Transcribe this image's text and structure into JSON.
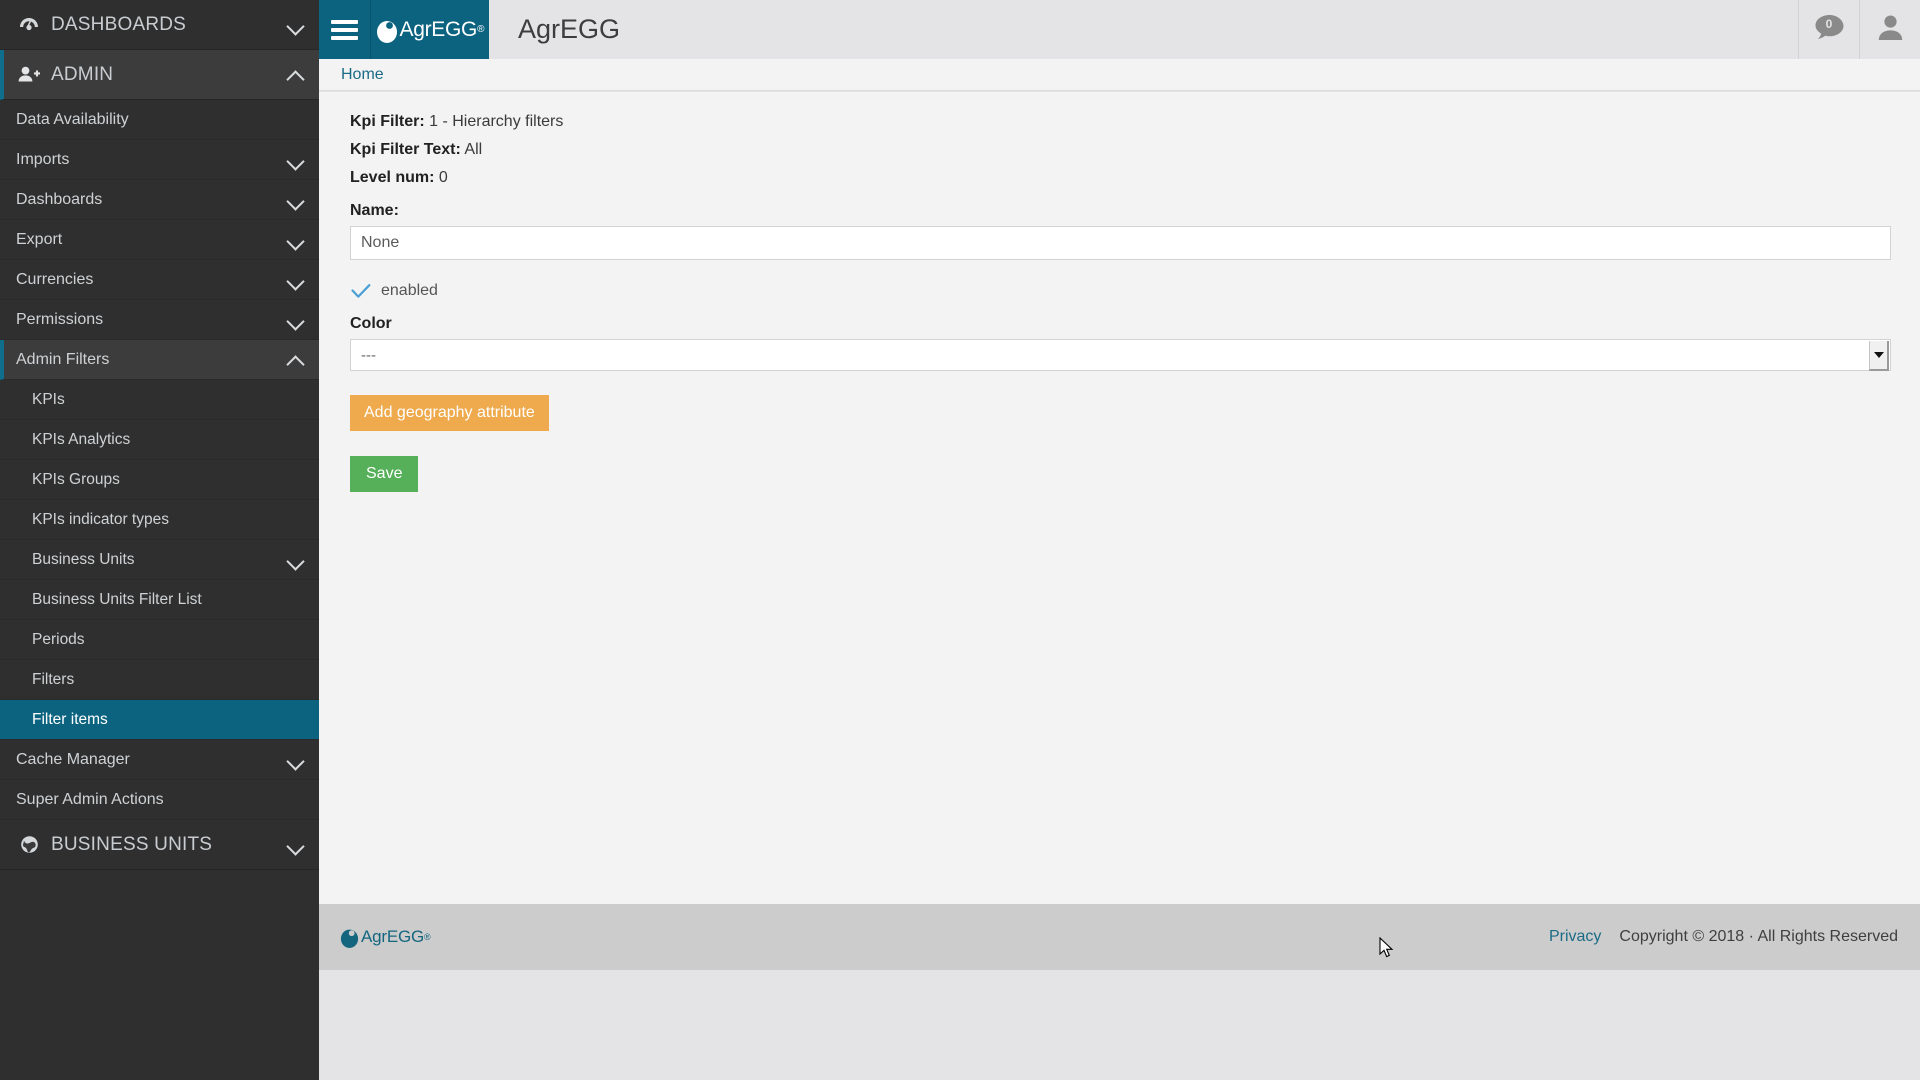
{
  "app": {
    "brand_name": "AgrEGG",
    "brand_reg": "®",
    "header_title": "AgrEGG",
    "notif_count": "0",
    "menu_icon": "hamburger-icon",
    "notif_icon": "speech-bubble-icon",
    "user_icon": "user-avatar-icon"
  },
  "breadcrumb": {
    "home": "Home"
  },
  "sidebar": {
    "sections": [
      {
        "label": "DASHBOARDS",
        "icon": "dashboard-gauge-icon",
        "chevron": "chevron-down-icon",
        "active": false
      },
      {
        "label": "ADMIN",
        "icon": "user-add-icon",
        "chevron": "chevron-up-icon",
        "active": true
      }
    ],
    "admin_items": [
      {
        "label": "Data Availability",
        "chevron": ""
      },
      {
        "label": "Imports",
        "chevron": "chevron-down-icon"
      },
      {
        "label": "Dashboards",
        "chevron": "chevron-down-icon"
      },
      {
        "label": "Export",
        "chevron": "chevron-down-icon"
      },
      {
        "label": "Currencies",
        "chevron": "chevron-down-icon"
      },
      {
        "label": "Permissions",
        "chevron": "chevron-down-icon"
      },
      {
        "label": "Admin Filters",
        "chevron": "chevron-up-icon"
      }
    ],
    "admin_filters_children": [
      {
        "label": "KPIs",
        "chevron": ""
      },
      {
        "label": "KPIs Analytics",
        "chevron": ""
      },
      {
        "label": "KPIs Groups",
        "chevron": ""
      },
      {
        "label": "KPIs indicator types",
        "chevron": ""
      },
      {
        "label": "Business Units",
        "chevron": "chevron-down-icon"
      },
      {
        "label": "Business Units Filter List",
        "chevron": ""
      },
      {
        "label": "Periods",
        "chevron": ""
      },
      {
        "label": "Filters",
        "chevron": ""
      },
      {
        "label": "Filter items",
        "chevron": "",
        "active": true
      }
    ],
    "admin_tail_items": [
      {
        "label": "Cache Manager",
        "chevron": "chevron-down-icon"
      },
      {
        "label": "Super Admin Actions",
        "chevron": ""
      }
    ],
    "bottom_sections": [
      {
        "label": "BUSINESS UNITS",
        "icon": "globe-icon",
        "chevron": "chevron-down-icon"
      }
    ]
  },
  "main": {
    "kpi_filter_label": "Kpi Filter:",
    "kpi_filter_value": "1 - Hierarchy filters",
    "kpi_filter_text_label": "Kpi Filter Text:",
    "kpi_filter_text_value": "All",
    "level_num_label": "Level num:",
    "level_num_value": "0",
    "name_label": "Name:",
    "name_value": "None",
    "name_placeholder": "None",
    "enabled_label": "enabled",
    "enabled_icon": "check-icon",
    "color_label": "Color",
    "color_value": "---",
    "color_options": [
      "---"
    ],
    "add_geography_label": "Add geography attribute",
    "save_label": "Save"
  },
  "footer": {
    "brand_name": "AgrEGG",
    "brand_reg": "®",
    "privacy": "Privacy",
    "copyright": "Copyright © 2018 · All Rights Reserved"
  },
  "colors": {
    "teal": "#0c6380",
    "sidebar_bg": "#2f2f2f",
    "sidebar_active": "#0c6380",
    "orange_button": "#eeaa4d",
    "green_button": "#56b05a",
    "link": "#1b6b87"
  }
}
